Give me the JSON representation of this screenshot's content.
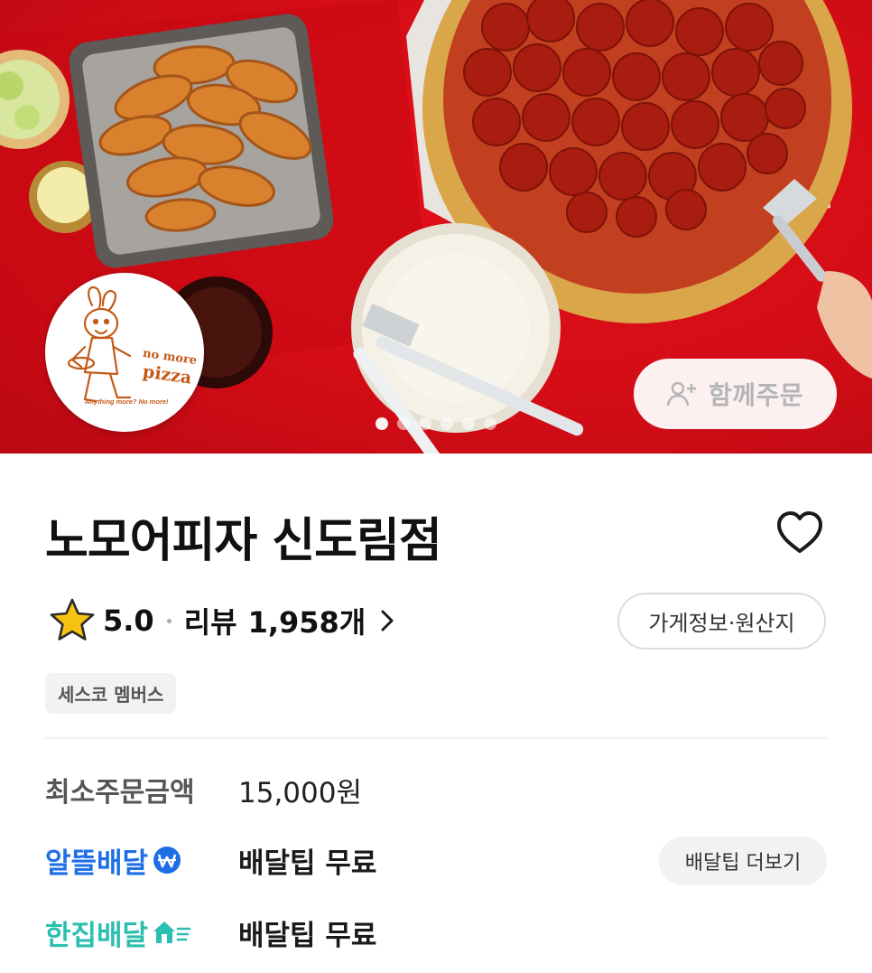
{
  "hero": {
    "logo": {
      "line1": "no more",
      "line2": "pizza",
      "tagline": "Anything more? No more!"
    },
    "group_order_label": "함께주문",
    "carousel": {
      "count": 6,
      "active_index": 0
    }
  },
  "store": {
    "name": "노모어피자 신도림점",
    "rating": "5.0",
    "review_label": "리뷰",
    "review_count": "1,958개",
    "info_button_label": "가게정보·원산지",
    "badge": "세스코 멤버스"
  },
  "details": {
    "min_order_label": "최소주문금액",
    "min_order_value": "15,000원",
    "delivery_options": [
      {
        "label": "알뜰배달",
        "fee": "배달팁 무료",
        "color": "#1e6ee6"
      },
      {
        "label": "한집배달",
        "fee": "배달팁 무료",
        "color": "#2bbfb0"
      }
    ],
    "tip_more_label": "배달팁 더보기"
  },
  "colors": {
    "hero_red": "#d40d16",
    "star_yellow": "#f7c313",
    "blue": "#1e6ee6",
    "teal": "#2bbfb0"
  }
}
